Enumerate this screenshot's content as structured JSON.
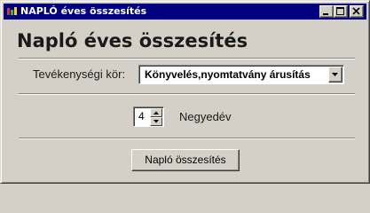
{
  "window": {
    "title": "NAPLÓ éves összesítés",
    "icon": "app-icon",
    "controls": [
      "minimize-icon",
      "maximize-icon",
      "close-icon"
    ]
  },
  "form": {
    "heading": "Napló éves összesítés",
    "activity_label": "Tevékenységi kör:",
    "activity_selected": "Könyvelés,nyomtatvány árusítás",
    "quarter_value": "4",
    "quarter_label": "Negyedév",
    "summary_button": "Napló összesítés"
  },
  "colors": {
    "titlebar": "#000080",
    "window_bg": "#d4d0c8",
    "field_bg": "#ffffff"
  }
}
